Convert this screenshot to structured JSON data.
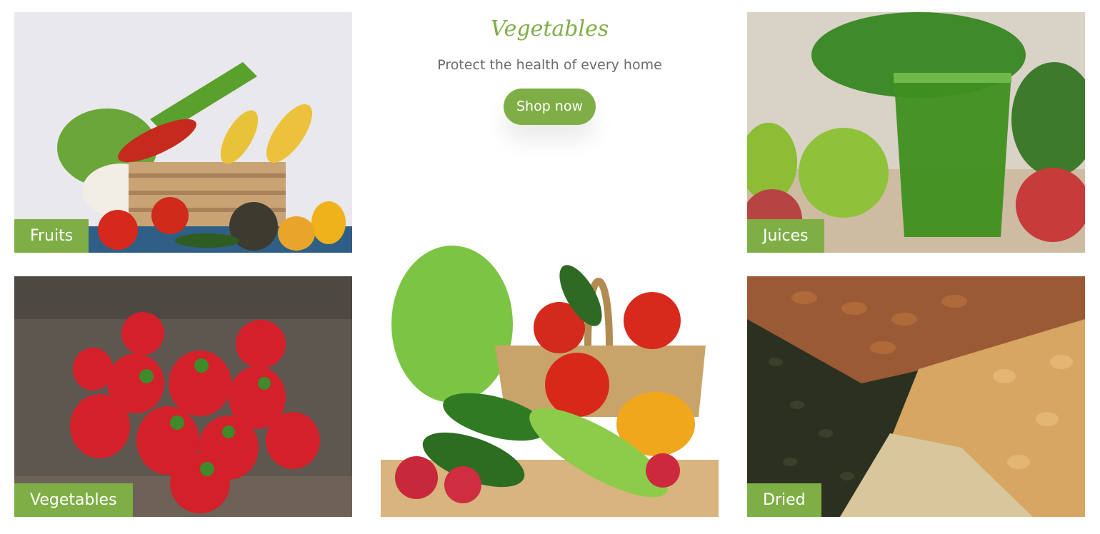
{
  "promo": {
    "title": "Vegetables",
    "subtitle": "Protect the health of every home",
    "button_label": "Shop now"
  },
  "tiles": [
    {
      "label": "Fruits",
      "image": "fruit-vegetable-basket-photo"
    },
    {
      "label": "Juices",
      "image": "green-juice-apples-photo"
    },
    {
      "label": "Vegetables",
      "image": "strawberries-photo"
    },
    {
      "label": "",
      "image": "vegetable-basket-photo"
    },
    {
      "label": "Dried",
      "image": "nuts-seeds-photo"
    }
  ],
  "colors": {
    "accent": "#7fae47",
    "text_muted": "#6b6b6b",
    "background": "#ffffff"
  }
}
